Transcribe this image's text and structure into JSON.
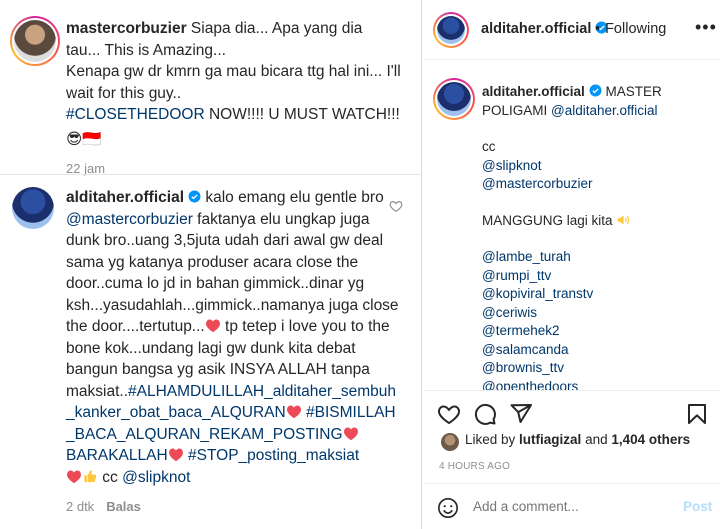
{
  "comment1": {
    "username": "mastercorbuzier",
    "text_a": " Siapa dia... Apa yang dia tau... This is Amazing...",
    "text_b": "Kenapa gw dr kmrn ga mau bicara ttg hal ini... I'll wait for this guy..",
    "hashtag": "#CLOSETHEDOOR",
    "text_c": " NOW!!!! U MUST WATCH!!!",
    "emojis": "😎🇮🇩",
    "time": "22 jam"
  },
  "comment2": {
    "username": "alditaher.official",
    "text_a": " kalo emang elu gentle bro ",
    "mention": "@mastercorbuzier",
    "text_b": " faktanya elu ungkap juga dunk bro..uang 3,5juta udah dari awal gw deal sama yg katanya produser acara close the door..cuma lo jd in bahan gimmick..dinar yg ksh...yasudahlah...gimmick..namanya juga close the door....tertutup...",
    "text_c": " tp tetep i love you to the bone kok...undang lagi gw dunk kita debat bangun bangsa yg asik INSYA ALLAH tanpa maksiat..",
    "tag1": "#ALHAMDULILLAH_alditaher_sembuh_kanker_obat_baca_ALQURAN",
    "tag2": "#BISMILLAH_BACA_ALQURAN_REKAM_POSTING",
    "tag3": "BARAKALLAH",
    "tag4": "#STOP_posting_maksiat",
    "cc": " cc ",
    "cc_mention": "@slipknot",
    "time": "2 dtk",
    "reply": "Balas"
  },
  "post": {
    "username": "alditaher.official",
    "follow_sep": "•",
    "follow_label": "Following",
    "more": "•••",
    "caption_user": "alditaher.official",
    "caption_text": " MASTER POLIGAMI ",
    "caption_mention": "@alditaher.official",
    "cc_label": "cc",
    "mentions_top": [
      "@slipknot",
      "@mastercorbuzier"
    ],
    "manggung": "MANGGUNG lagi kita ",
    "mentions": [
      "@lambe_turah",
      "@rumpi_ttv",
      "@kopiviral_transtv",
      "@ceriwis",
      "@termehek2",
      "@salamcanda",
      "@brownis_ttv",
      "@openthedoors"
    ],
    "caption_time": "4h",
    "liked_prefix": "Liked by ",
    "liked_user": "lutfiagizal",
    "liked_and": " and ",
    "liked_count": "1,404 others",
    "posted": "4 HOURS AGO",
    "add_placeholder": "Add a comment...",
    "post_label": "Post"
  },
  "colors": {
    "link": "#00376b",
    "meta": "#8e8e8e",
    "verified": "#0095f6",
    "heart": "#ed4956",
    "post_disabled": "#b2dffc"
  }
}
